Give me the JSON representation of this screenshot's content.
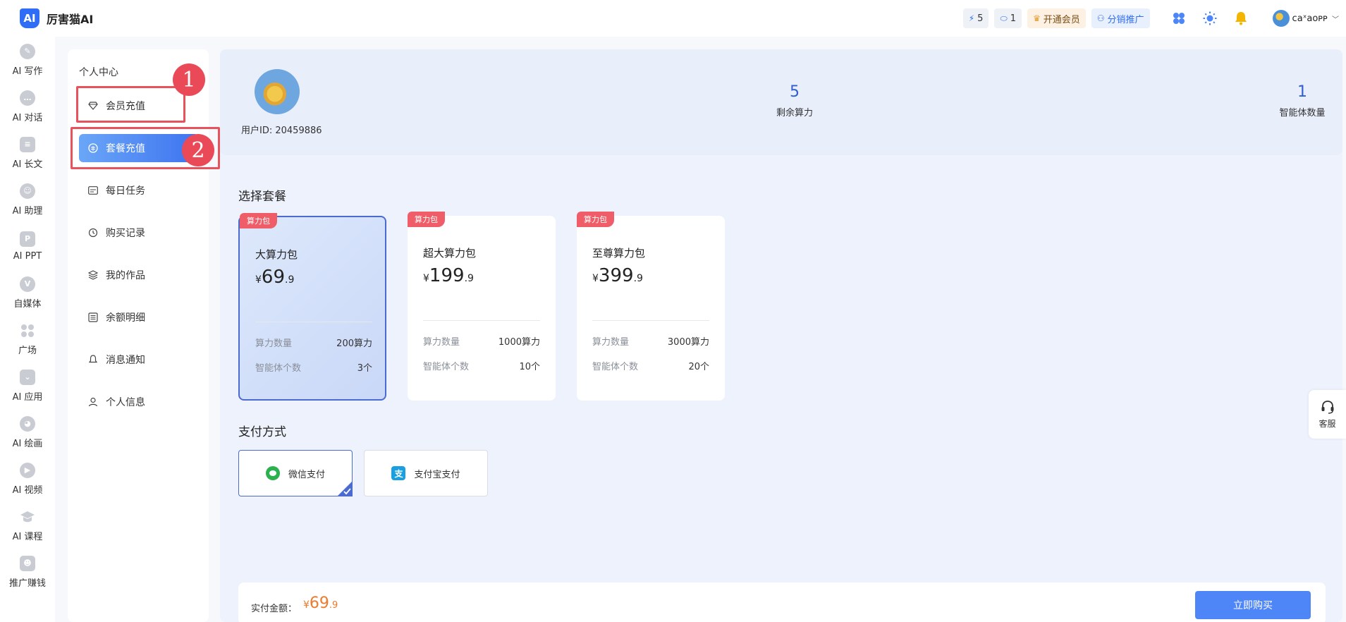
{
  "app": {
    "logo_mark": "AI",
    "title": "厉害猫AI"
  },
  "topbar": {
    "power_count": "5",
    "agent_count": "1",
    "vip_label": "开通会员",
    "share_label": "分销推广",
    "username": "caˣaoᴘᴘ"
  },
  "rail": {
    "items": [
      {
        "label": "AI 写作",
        "icon": "pen-icon"
      },
      {
        "label": "AI 对话",
        "icon": "chat-icon"
      },
      {
        "label": "AI 长文",
        "icon": "document-icon"
      },
      {
        "label": "AI 助理",
        "icon": "assistant-icon"
      },
      {
        "label": "AI PPT",
        "icon": "ppt-icon"
      },
      {
        "label": "自媒体",
        "icon": "media-icon"
      },
      {
        "label": "广场",
        "icon": "grid-icon"
      },
      {
        "label": "AI 应用",
        "icon": "app-icon"
      },
      {
        "label": "AI 绘画",
        "icon": "palette-icon"
      },
      {
        "label": "AI 视频",
        "icon": "video-icon"
      },
      {
        "label": "AI 课程",
        "icon": "graduation-icon"
      },
      {
        "label": "推广赚钱",
        "icon": "promo-icon"
      }
    ]
  },
  "submenu": {
    "title": "个人中心",
    "items": [
      {
        "label": "会员充值",
        "icon": "diamond-icon"
      },
      {
        "label": "套餐充值",
        "icon": "package-icon"
      },
      {
        "label": "每日任务",
        "icon": "task-icon"
      },
      {
        "label": "购买记录",
        "icon": "history-icon"
      },
      {
        "label": "我的作品",
        "icon": "layers-icon"
      },
      {
        "label": "余额明细",
        "icon": "list-icon"
      },
      {
        "label": "消息通知",
        "icon": "bell-icon"
      },
      {
        "label": "个人信息",
        "icon": "user-icon"
      }
    ],
    "annotation_1": "1",
    "annotation_2": "2"
  },
  "profile": {
    "user_id": "用户ID: 20459886",
    "remaining_power_value": "5",
    "remaining_power_label": "剩余算力",
    "agent_count_value": "1",
    "agent_count_label": "智能体数量"
  },
  "packages": {
    "section_title": "选择套餐",
    "items": [
      {
        "tag": "算力包",
        "name": "大算力包",
        "currency": "¥",
        "price_int": "69",
        "price_dec": ".9",
        "power_label": "算力数量",
        "power_value": "200算力",
        "agent_label": "智能体个数",
        "agent_value": "3个"
      },
      {
        "tag": "算力包",
        "name": "超大算力包",
        "currency": "¥",
        "price_int": "199",
        "price_dec": ".9",
        "power_label": "算力数量",
        "power_value": "1000算力",
        "agent_label": "智能体个数",
        "agent_value": "10个"
      },
      {
        "tag": "算力包",
        "name": "至尊算力包",
        "currency": "¥",
        "price_int": "399",
        "price_dec": ".9",
        "power_label": "算力数量",
        "power_value": "3000算力",
        "agent_label": "智能体个数",
        "agent_value": "20个"
      }
    ]
  },
  "payment": {
    "section_title": "支付方式",
    "wechat": "微信支付",
    "alipay": "支付宝支付"
  },
  "footer": {
    "total_label": "实付金额：",
    "currency": "¥",
    "total_int": "69",
    "total_dec": ".9",
    "buy_label": "立即购买"
  },
  "support": {
    "label": "客服"
  },
  "colors": {
    "accent": "#4f86f7",
    "tag_red": "#ee5d68",
    "price_orange": "#ee7a2d",
    "annotation_red": "#e8525c"
  }
}
